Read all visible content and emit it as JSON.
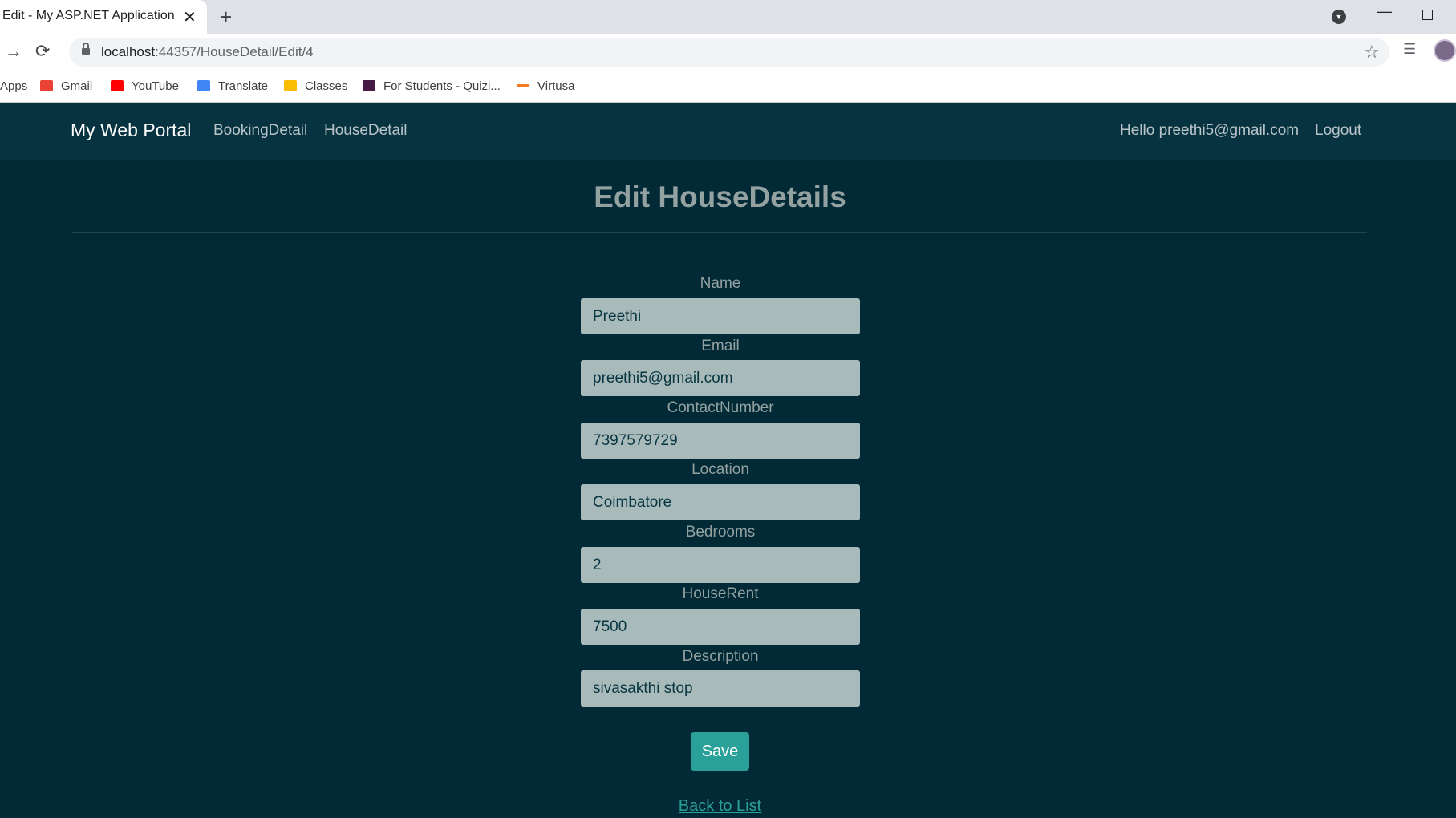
{
  "browser": {
    "tab_title": "Edit - My ASP.NET Application",
    "url_host": "localhost",
    "url_path": ":44357/HouseDetail/Edit/4",
    "bookmarks": [
      {
        "label": "Apps",
        "icon": "apps-icon"
      },
      {
        "label": "Gmail",
        "icon": "gmail-icon",
        "color": "#ea4335"
      },
      {
        "label": "YouTube",
        "icon": "youtube-icon",
        "color": "#ff0000"
      },
      {
        "label": "Translate",
        "icon": "translate-icon",
        "color": "#4285f4"
      },
      {
        "label": "Classes",
        "icon": "classes-icon",
        "color": "#fbbc04"
      },
      {
        "label": "For Students - Quizi...",
        "icon": "quizizz-icon",
        "color": "#461a42"
      },
      {
        "label": "Virtusa",
        "icon": "virtusa-icon",
        "color": "#f47b20"
      }
    ]
  },
  "navbar": {
    "brand": "My Web Portal",
    "links": [
      "BookingDetail",
      "HouseDetail"
    ],
    "greeting": "Hello preethi5@gmail.com",
    "logout": "Logout"
  },
  "page": {
    "title": "Edit HouseDetails"
  },
  "form": {
    "fields": [
      {
        "label": "Name",
        "value": "Preethi"
      },
      {
        "label": "Email",
        "value": "preethi5@gmail.com"
      },
      {
        "label": "ContactNumber",
        "value": "7397579729"
      },
      {
        "label": "Location",
        "value": "Coimbatore"
      },
      {
        "label": "Bedrooms",
        "value": "2"
      },
      {
        "label": "HouseRent",
        "value": "7500"
      },
      {
        "label": "Description",
        "value": "sivasakthi stop"
      }
    ],
    "save_label": "Save",
    "back_link": "Back to List"
  },
  "colors": {
    "page_bg": "#012a36",
    "navbar_bg": "#073340",
    "input_bg": "#a9baba",
    "accent": "#2aa198"
  }
}
